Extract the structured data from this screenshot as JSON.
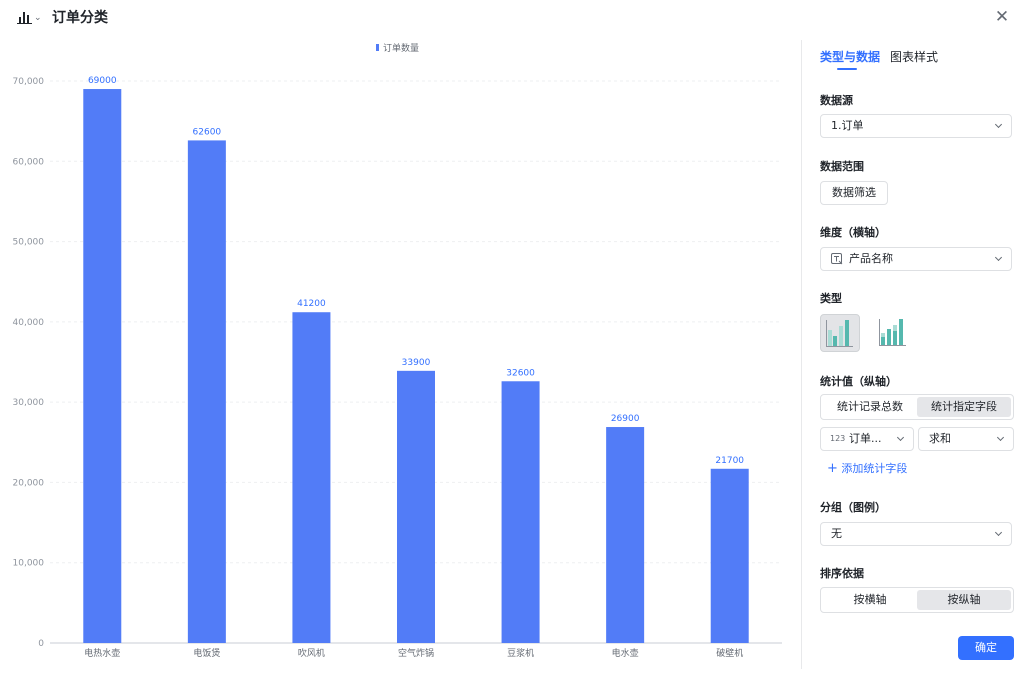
{
  "header": {
    "title": "订单分类",
    "close_glyph": "✕",
    "chart_icon": "bar-chart-icon"
  },
  "panel": {
    "tabs": [
      {
        "label": "类型与数据",
        "active": true
      },
      {
        "label": "图表样式",
        "active": false
      }
    ],
    "data_source": {
      "label": "数据源",
      "value": "1.订单"
    },
    "data_range": {
      "label": "数据范围",
      "button": "数据筛选"
    },
    "dimension": {
      "label": "维度（横轴）",
      "value": "产品名称",
      "icon": "text-field-icon"
    },
    "type": {
      "label": "类型",
      "options": [
        "clustered-bar-icon",
        "stacked-bar-icon"
      ],
      "selected": 0
    },
    "measure": {
      "label": "统计值（纵轴）",
      "options": [
        "统计记录总数",
        "统计指定字段"
      ],
      "selected": 1,
      "field_icon_text": "123",
      "field_value": "订单...",
      "aggregate_value": "求和",
      "add_label": "添加统计字段"
    },
    "group": {
      "label": "分组（图例）",
      "value": "无"
    },
    "sort": {
      "label": "排序依据",
      "options": [
        "按横轴",
        "按纵轴"
      ],
      "selected": 1
    },
    "confirm": "确定"
  },
  "colors": {
    "accent": "#3370ff",
    "bar": "#527cf7",
    "teal": "#55b8ae",
    "teal_light": "#a9dcd5"
  },
  "chart_data": {
    "type": "bar",
    "categories": [
      "电热水壶",
      "电饭煲",
      "吹风机",
      "空气炸锅",
      "豆浆机",
      "电水壶",
      "破壁机"
    ],
    "series": [
      {
        "name": "订单数量",
        "values": [
          69000,
          62600,
          41200,
          33900,
          32600,
          26900,
          21700
        ]
      }
    ],
    "ylim": [
      0,
      70000
    ],
    "yticks": [
      0,
      10000,
      20000,
      30000,
      40000,
      50000,
      60000,
      70000
    ],
    "ytick_labels": [
      "0",
      "10,000",
      "20,000",
      "30,000",
      "40,000",
      "50,000",
      "60,000",
      "70,000"
    ],
    "grid": true,
    "legend": "top-center",
    "data_labels": true
  }
}
